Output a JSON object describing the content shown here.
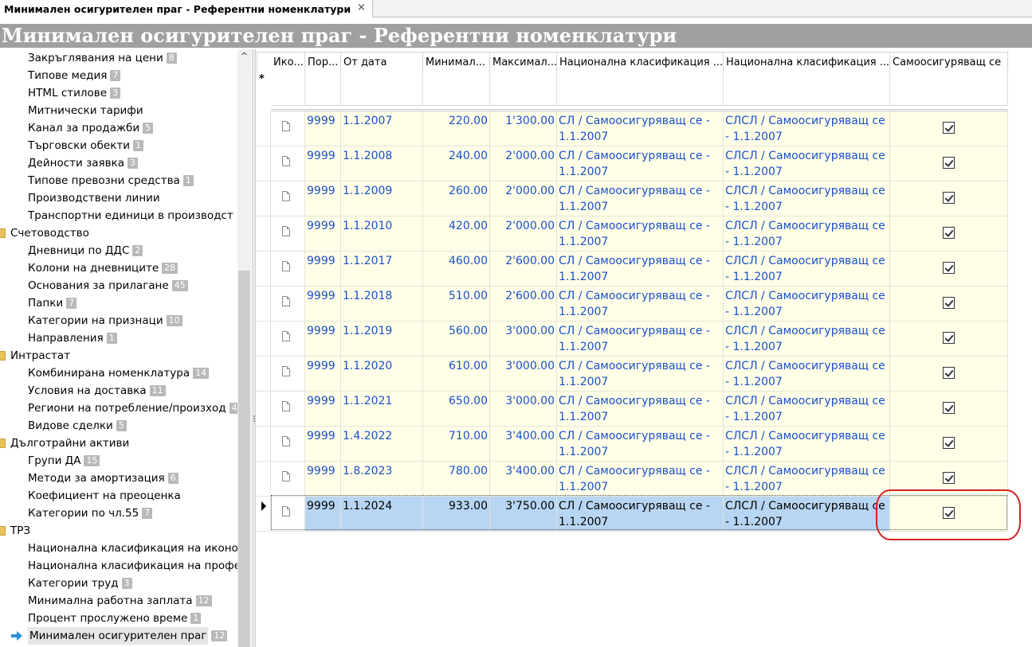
{
  "tab": {
    "label": "Минимален осигурителен праг - Референтни номенклатури",
    "close": "×"
  },
  "title": "Минимален осигурителен праг - Референтни номенклатури",
  "sidebar": {
    "scroll_up": "^",
    "items": [
      {
        "label": "Закръглявания на цени",
        "badge": "8",
        "level": 1
      },
      {
        "label": "Типове медия",
        "badge": "7",
        "level": 1
      },
      {
        "label": "HTML стилове",
        "badge": "3",
        "level": 1
      },
      {
        "label": "Митнически тарифи",
        "badge": "",
        "level": 1
      },
      {
        "label": "Канал за продажби",
        "badge": "5",
        "level": 1
      },
      {
        "label": "Търговски обекти",
        "badge": "1",
        "level": 1
      },
      {
        "label": "Дейности заявка",
        "badge": "3",
        "level": 1
      },
      {
        "label": "Типове превозни средства",
        "badge": "1",
        "level": 1
      },
      {
        "label": "Производствени линии",
        "badge": "",
        "level": 1
      },
      {
        "label": "Транспортни единици в производст",
        "badge": "",
        "level": 1
      },
      {
        "label": "Счетоводство",
        "badge": "",
        "level": 0
      },
      {
        "label": "Дневници по ДДС",
        "badge": "2",
        "level": 1
      },
      {
        "label": "Колони на дневниците",
        "badge": "28",
        "level": 1
      },
      {
        "label": "Основания за прилагане",
        "badge": "45",
        "level": 1
      },
      {
        "label": "Папки",
        "badge": "7",
        "level": 1
      },
      {
        "label": "Категории на признаци",
        "badge": "10",
        "level": 1
      },
      {
        "label": "Направления",
        "badge": "1",
        "level": 1
      },
      {
        "label": "Интрастат",
        "badge": "",
        "level": 0
      },
      {
        "label": "Комбинирана номенклатура",
        "badge": "14",
        "level": 1
      },
      {
        "label": "Условия на доставка",
        "badge": "11",
        "level": 1
      },
      {
        "label": "Региони на потребление/произход",
        "badge": "4",
        "level": 1
      },
      {
        "label": "Видове сделки",
        "badge": "5",
        "level": 1
      },
      {
        "label": "Дълготрайни активи",
        "badge": "",
        "level": 0
      },
      {
        "label": "Групи ДА",
        "badge": "15",
        "level": 1
      },
      {
        "label": "Методи за амортизация",
        "badge": "6",
        "level": 1
      },
      {
        "label": "Коефициент на преоценка",
        "badge": "",
        "level": 1
      },
      {
        "label": "Категории по чл.55",
        "badge": "7",
        "level": 1
      },
      {
        "label": "ТРЗ",
        "badge": "",
        "level": 0
      },
      {
        "label": "Национална класификация на иконо",
        "badge": "",
        "level": 1
      },
      {
        "label": "Национална класификация на профе",
        "badge": "",
        "level": 1
      },
      {
        "label": "Категории труд",
        "badge": "3",
        "level": 1
      },
      {
        "label": "Минимална работна заплата",
        "badge": "12",
        "level": 1
      },
      {
        "label": "Процент прослужено време",
        "badge": "1",
        "level": 1
      },
      {
        "label": "Минимален осигурителен праг",
        "badge": "12",
        "level": 1,
        "selected": true
      }
    ]
  },
  "grid": {
    "new_row_marker": "*",
    "columns": [
      "Ико...",
      "Пор...",
      "От дата",
      "Минимал...",
      "Максимал...",
      "Национална класификация ...",
      "Национална класификация ...",
      "Самоосигуряващ се"
    ],
    "rows": [
      {
        "no": "9999",
        "date": "1.1.2007",
        "min": "220.00",
        "max": "1'300.00",
        "nk1": "СЛ / Самоосигуряващ се - 1.1.2007",
        "nk2": "СЛСЛ / Самоосигуряващ се - 1.1.2007",
        "self": true
      },
      {
        "no": "9999",
        "date": "1.1.2008",
        "min": "240.00",
        "max": "2'000.00",
        "nk1": "СЛ / Самоосигуряващ се - 1.1.2007",
        "nk2": "СЛСЛ / Самоосигуряващ се - 1.1.2007",
        "self": true
      },
      {
        "no": "9999",
        "date": "1.1.2009",
        "min": "260.00",
        "max": "2'000.00",
        "nk1": "СЛ / Самоосигуряващ се - 1.1.2007",
        "nk2": "СЛСЛ / Самоосигуряващ се - 1.1.2007",
        "self": true
      },
      {
        "no": "9999",
        "date": "1.1.2010",
        "min": "420.00",
        "max": "2'000.00",
        "nk1": "СЛ / Самоосигуряващ се - 1.1.2007",
        "nk2": "СЛСЛ / Самоосигуряващ се - 1.1.2007",
        "self": true
      },
      {
        "no": "9999",
        "date": "1.1.2017",
        "min": "460.00",
        "max": "2'600.00",
        "nk1": "СЛ / Самоосигуряващ се - 1.1.2007",
        "nk2": "СЛСЛ / Самоосигуряващ се - 1.1.2007",
        "self": true
      },
      {
        "no": "9999",
        "date": "1.1.2018",
        "min": "510.00",
        "max": "2'600.00",
        "nk1": "СЛ / Самоосигуряващ се - 1.1.2007",
        "nk2": "СЛСЛ / Самоосигуряващ се - 1.1.2007",
        "self": true
      },
      {
        "no": "9999",
        "date": "1.1.2019",
        "min": "560.00",
        "max": "3'000.00",
        "nk1": "СЛ / Самоосигуряващ се - 1.1.2007",
        "nk2": "СЛСЛ / Самоосигуряващ се - 1.1.2007",
        "self": true
      },
      {
        "no": "9999",
        "date": "1.1.2020",
        "min": "610.00",
        "max": "3'000.00",
        "nk1": "СЛ / Самоосигуряващ се - 1.1.2007",
        "nk2": "СЛСЛ / Самоосигуряващ се - 1.1.2007",
        "self": true
      },
      {
        "no": "9999",
        "date": "1.1.2021",
        "min": "650.00",
        "max": "3'000.00",
        "nk1": "СЛ / Самоосигуряващ се - 1.1.2007",
        "nk2": "СЛСЛ / Самоосигуряващ се - 1.1.2007",
        "self": true
      },
      {
        "no": "9999",
        "date": "1.4.2022",
        "min": "710.00",
        "max": "3'400.00",
        "nk1": "СЛ / Самоосигуряващ се - 1.1.2007",
        "nk2": "СЛСЛ / Самоосигуряващ се - 1.1.2007",
        "self": true
      },
      {
        "no": "9999",
        "date": "1.8.2023",
        "min": "780.00",
        "max": "3'400.00",
        "nk1": "СЛ / Самоосигуряващ се - 1.1.2007",
        "nk2": "СЛСЛ / Самоосигуряващ се - 1.1.2007",
        "self": true
      },
      {
        "no": "9999",
        "date": "1.1.2024",
        "min": "933.00",
        "max": "3'750.00",
        "nk1": "СЛ / Самоосигуряващ се - 1.1.2007",
        "nk2": "СЛСЛ / Самоосигуряващ се - 1.1.2007",
        "self": true,
        "selected": true
      }
    ]
  },
  "colors": {
    "row_bg": "#ffffe8",
    "selected_bg": "#b8d6f3",
    "link_text": "#1b4fc9",
    "title_bg": "#a0a0a0",
    "annotation": "#d62020"
  }
}
